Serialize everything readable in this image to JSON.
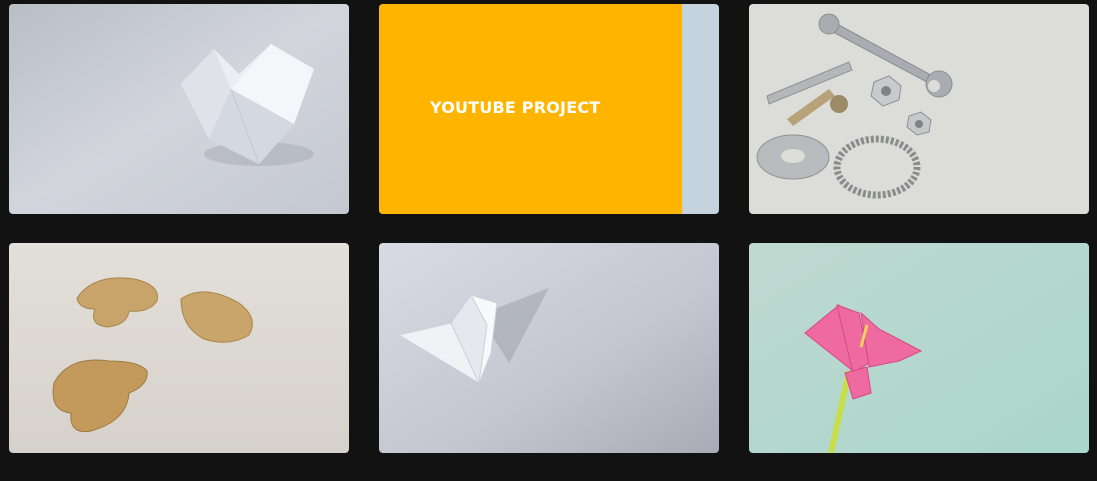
{
  "gallery": {
    "items": [
      {
        "id": 1,
        "image": "origami-fortune-teller"
      },
      {
        "id": 2,
        "image": "project-hover",
        "overlay_title": "YOUTUBE PROJECT",
        "overlay_color": "#ffb400"
      },
      {
        "id": 3,
        "image": "hardware-tools"
      },
      {
        "id": 4,
        "image": "fortune-cookies"
      },
      {
        "id": 5,
        "image": "origami-butterfly"
      },
      {
        "id": 6,
        "image": "origami-lily-flower"
      }
    ]
  }
}
